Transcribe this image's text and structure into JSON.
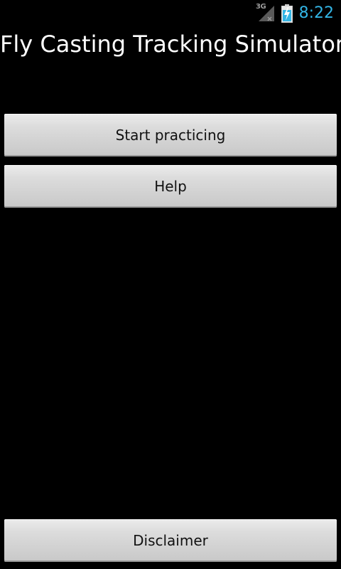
{
  "status_bar": {
    "network_type": "3G",
    "signal_icon": "signal-strength-icon",
    "battery_icon": "battery-charging-icon",
    "time": "8:22",
    "accent_color": "#33b5e5"
  },
  "app": {
    "title": "Fly Casting Tracking Simulator"
  },
  "buttons": {
    "start": "Start practicing",
    "help": "Help",
    "disclaimer": "Disclaimer"
  }
}
